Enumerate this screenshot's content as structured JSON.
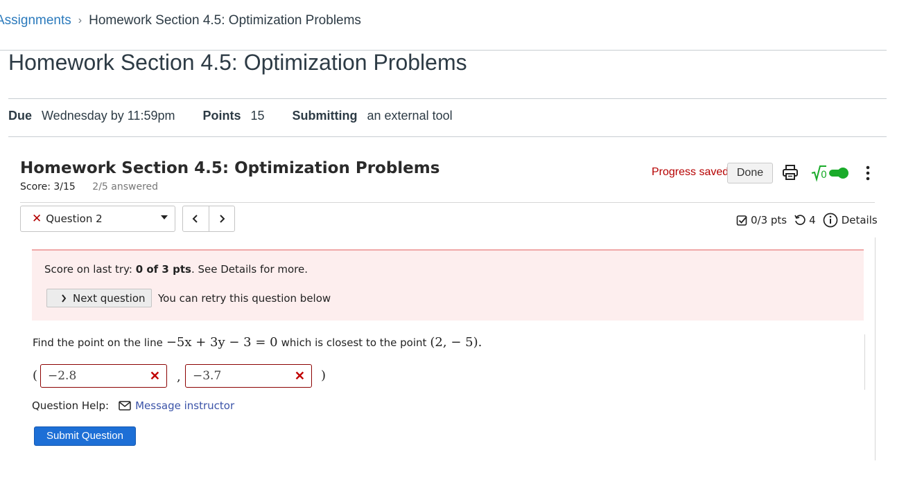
{
  "breadcrumb": {
    "parent": "Assignments",
    "separator": "›",
    "current": "Homework Section 4.5: Optimization Problems"
  },
  "page": {
    "title": "Homework Section 4.5: Optimization Problems"
  },
  "details": {
    "due_label": "Due",
    "due_value": "Wednesday by 11:59pm",
    "points_label": "Points",
    "points_value": "15",
    "submitting_label": "Submitting",
    "submitting_value": "an external tool"
  },
  "tool": {
    "title": "Homework Section 4.5: Optimization Problems",
    "score": "Score: 3/15",
    "answered": "2/5 answered",
    "progress_status": "Progress saved",
    "done_label": "Done",
    "toggle_icon": "sqrt-icon",
    "toggle_on": true
  },
  "question_nav": {
    "status_icon": "x-icon",
    "selected": "Question 2",
    "pts": "0/3 pts",
    "retries": "4",
    "details_label": "Details"
  },
  "alert": {
    "score_prefix": "Score on last try: ",
    "score_value": "0 of 3 pts",
    "score_suffix": ". See Details for more.",
    "next_label": "Next question",
    "retry_text": "You can retry this question below"
  },
  "question": {
    "text_before": "Find the point on the line",
    "equation": "−5x + 3y − 3 = 0",
    "text_middle": "which is closest to the point",
    "point": "(2, − 5).",
    "answer_x": "−2.8",
    "answer_y": "−3.7",
    "open_paren": "(",
    "comma": ",",
    "close_paren": ")",
    "help_label": "Question Help:",
    "message_link": "Message instructor",
    "submit_label": "Submit Question"
  },
  "colors": {
    "link": "#2b7abc",
    "error": "#b60000",
    "submit": "#1d6fd6",
    "toggle": "#1aab2a"
  }
}
